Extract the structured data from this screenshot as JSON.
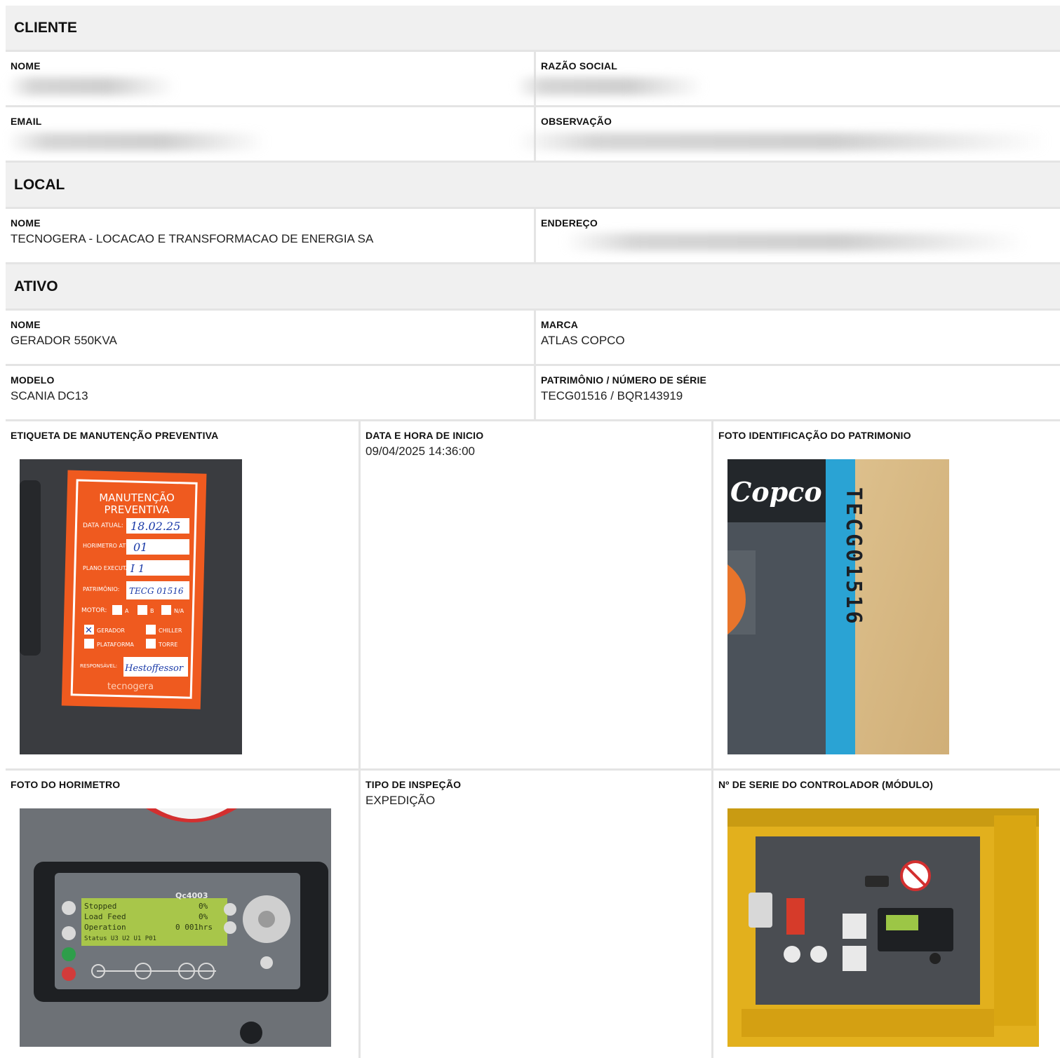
{
  "cliente": {
    "title": "CLIENTE",
    "nome_label": "NOME",
    "razao_label": "RAZÃO SOCIAL",
    "email_label": "EMAIL",
    "obs_label": "OBSERVAÇÃO"
  },
  "local": {
    "title": "LOCAL",
    "nome_label": "NOME",
    "nome_value": "TECNOGERA - LOCACAO E TRANSFORMACAO DE ENERGIA SA",
    "endereco_label": "ENDEREÇO"
  },
  "ativo": {
    "title": "ATIVO",
    "nome_label": "NOME",
    "nome_value": "GERADOR 550KVA",
    "marca_label": "MARCA",
    "marca_value": "ATLAS COPCO",
    "modelo_label": "MODELO",
    "modelo_value": "SCANIA DC13",
    "patrimonio_label": "PATRIMÔNIO / NÚMERO DE SÉRIE",
    "patrimonio_value": "TECG01516 / BQR143919",
    "etiqueta_label": "ETIQUETA DE MANUTENÇÃO PREVENTIVA",
    "data_label": "DATA E HORA DE INICIO",
    "data_value": "09/04/2025 14:36:00",
    "foto_id_label": "FOTO IDENTIFICAÇÃO DO PATRIMONIO",
    "horimetro_label": "FOTO DO HORIMETRO",
    "tipo_label": "TIPO DE INSPEÇÃO",
    "tipo_value": "EXPEDIÇÃO",
    "serie_label": "Nº DE SERIE DO CONTROLADOR (MÓDULO)"
  },
  "photos": {
    "etiqueta": {
      "title1": "MANUTENÇÃO",
      "title2": "PREVENTIVA",
      "data_atual_label": "DATA ATUAL:",
      "data_atual_value": "18.02.25",
      "horimetro_label": "HORIMETRO ATUAL:",
      "horimetro_value": "01",
      "plano_label": "PLANO EXECUTADO:",
      "plano_value": "I 1",
      "patrimonio_label": "PATRIMÔNIO:",
      "patrimonio_value": "TECG 01516",
      "motor_label": "MOTOR:",
      "opt_a": "A",
      "opt_b": "B",
      "opt_na": "N/A",
      "gerador": "GERADOR",
      "chiller": "CHILLER",
      "plataforma": "PLATAFORMA",
      "torre": "TORRE",
      "responsavel_label": "RESPONSÁVEL:",
      "responsavel_value": "Hestoffessor",
      "brand": "tecnogera"
    },
    "identificacao": {
      "brand_text": "Copco",
      "plate_text": "TECG01516"
    },
    "horimetro": {
      "model": "Qc4003",
      "line1": "Stopped",
      "line1_val": "0%",
      "line2": "Load Feed",
      "line2_val": "0%",
      "line3": "Operation",
      "line3_val": "0 001hrs",
      "line4": "Status U3 U2 U1 P01"
    }
  },
  "colors": {
    "header_bg": "#f0f0f0",
    "border": "#e4e4e4",
    "label_orange": "#ee5a24",
    "plate_blue": "#2aa3d4",
    "panel_yellow": "#e6b422"
  }
}
